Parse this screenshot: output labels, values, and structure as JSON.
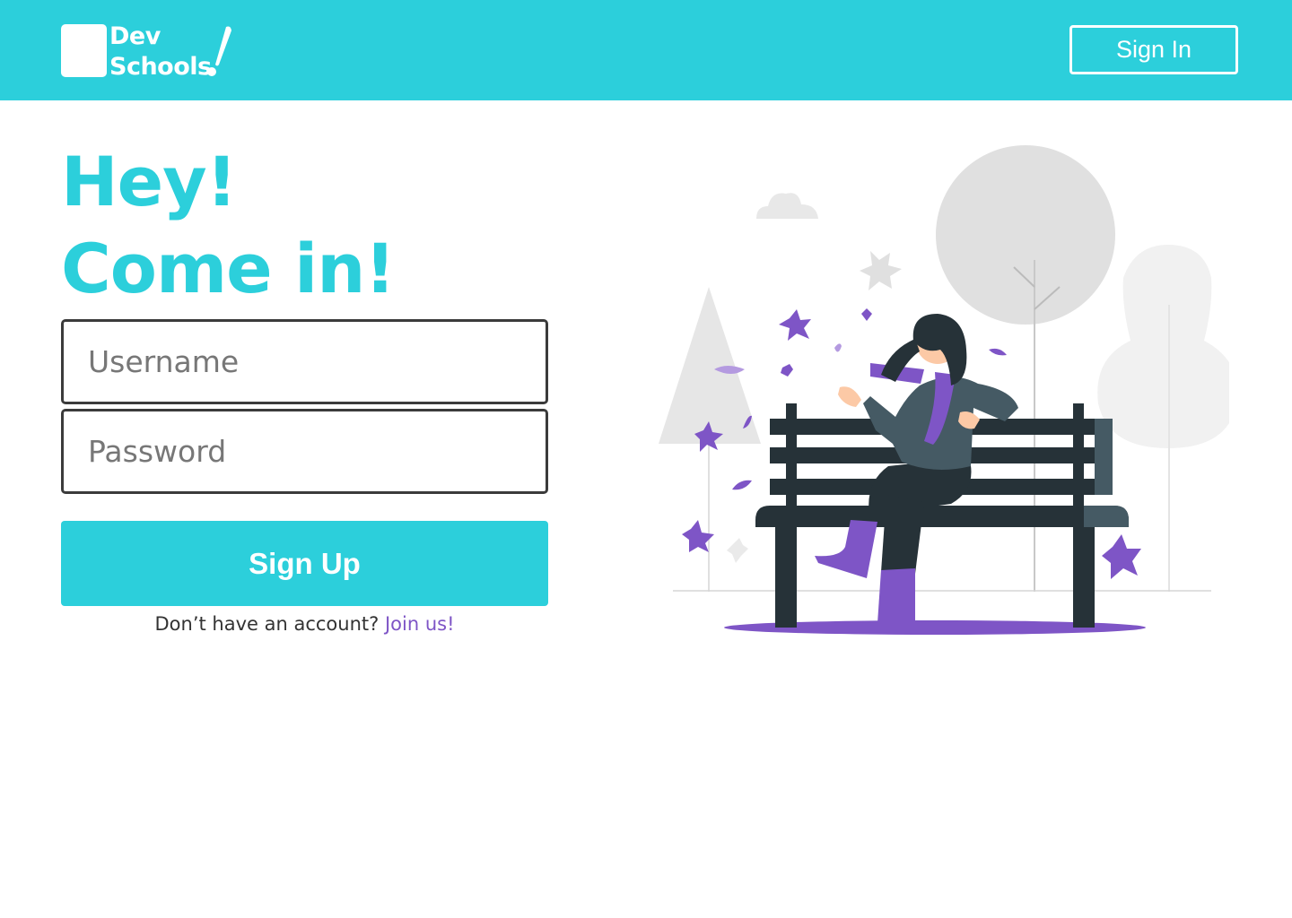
{
  "header": {
    "logo_line1": "Dev",
    "logo_line2": "Schools",
    "signin_label": "Sign In"
  },
  "hero": {
    "line1": "Hey!",
    "line2": "Come in!"
  },
  "form": {
    "username_placeholder": "Username",
    "password_placeholder": "Password",
    "signup_label": "Sign Up",
    "join_prompt": "Don’t have an account?",
    "join_link": "Join us!"
  },
  "colors": {
    "brand": "#2ccfdb",
    "accent": "#7e55c6",
    "border": "#3b3b3b"
  }
}
